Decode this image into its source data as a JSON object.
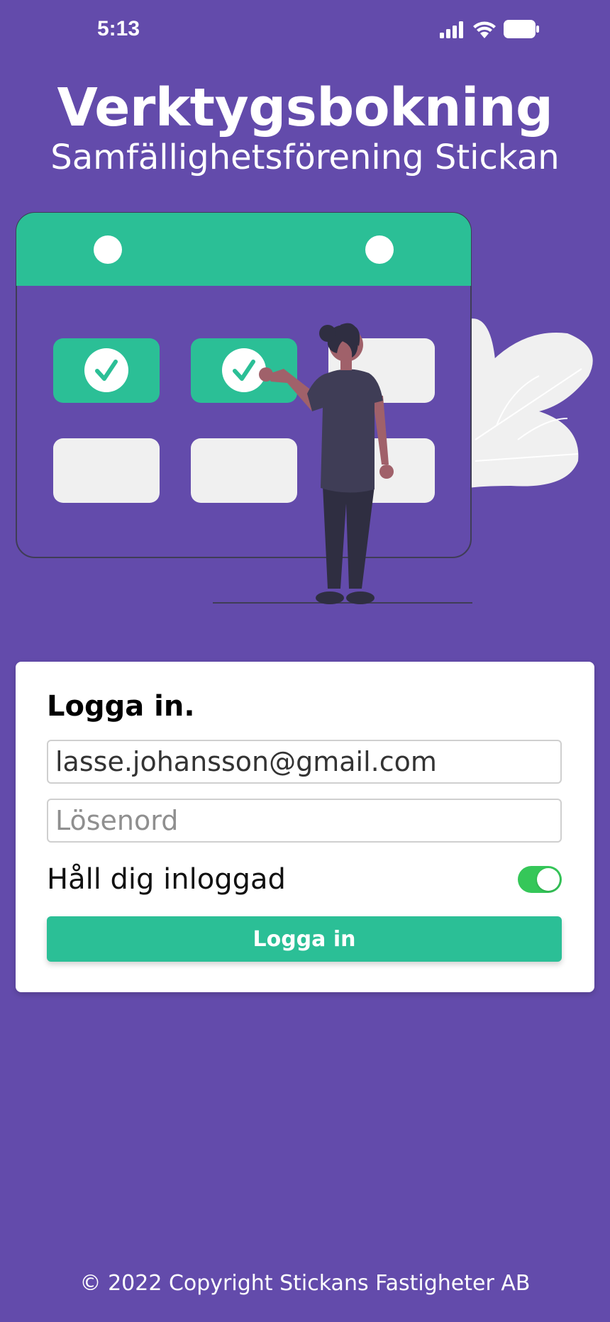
{
  "status_bar": {
    "time": "5:13",
    "icons": [
      "signal-icon",
      "wifi-icon",
      "battery-icon"
    ]
  },
  "header": {
    "title": "Verktygsbokning",
    "subtitle": "Samfällighetsförening Stickan"
  },
  "illustration": {
    "name": "calendar-booking-illustration",
    "colors": {
      "accent": "#2bbf96",
      "slot": "#f0f0f0",
      "background": "#634bab"
    }
  },
  "login": {
    "title": "Logga in.",
    "email_value": "lasse.johansson@gmail.com",
    "password_placeholder": "Lösenord",
    "remember_label": "Håll dig inloggad",
    "remember_on": true,
    "button_label": "Logga in"
  },
  "footer": {
    "copyright": "© 2022 Copyright Stickans Fastigheter AB"
  },
  "colors": {
    "background": "#634bab",
    "primary": "#2bbf96",
    "toggle_on": "#35c759",
    "card": "#ffffff"
  }
}
